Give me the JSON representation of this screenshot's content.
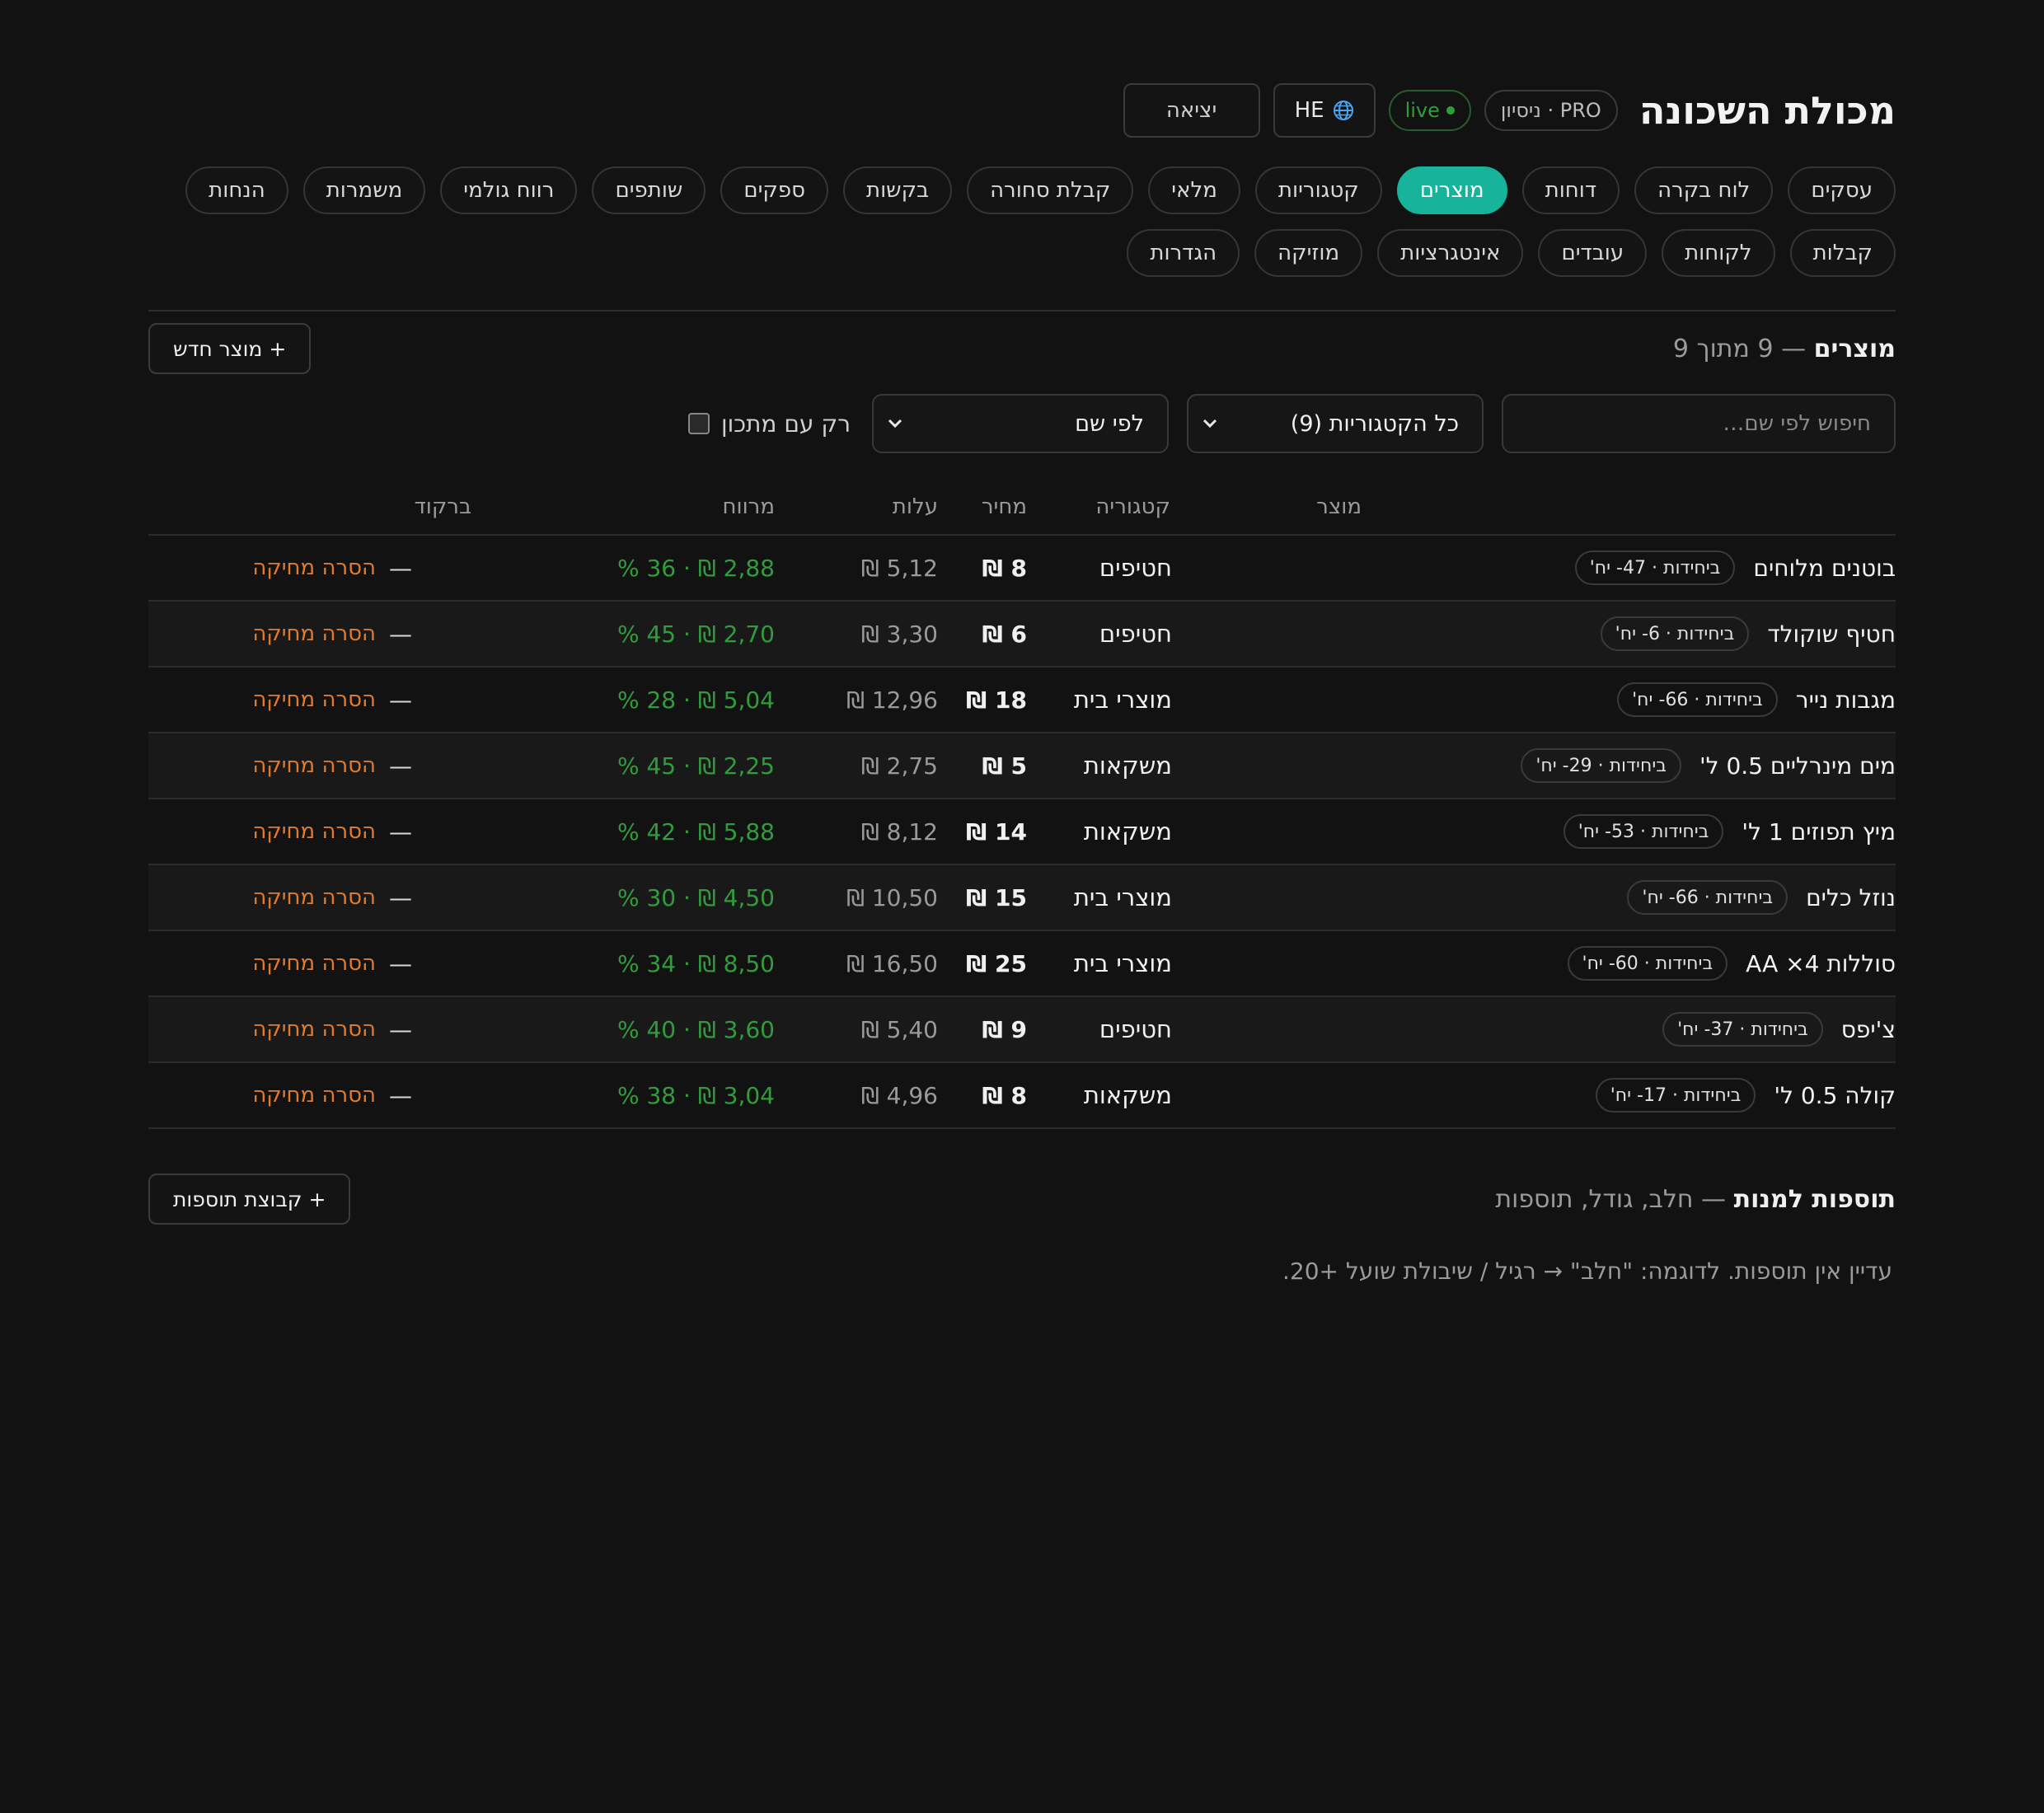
{
  "app": {
    "title": "מכולת השכונה",
    "plan_badge": "PRO · ניסיון",
    "live_label": "live",
    "lang_label": "HE",
    "logout_label": "יציאה"
  },
  "nav": {
    "items": [
      {
        "label": "עסקים"
      },
      {
        "label": "לוח בקרה"
      },
      {
        "label": "דוחות"
      },
      {
        "label": "מוצרים",
        "active": true
      },
      {
        "label": "קטגוריות"
      },
      {
        "label": "מלאי"
      },
      {
        "label": "קבלת סחורה"
      },
      {
        "label": "בקשות"
      },
      {
        "label": "ספקים"
      },
      {
        "label": "שותפים"
      },
      {
        "label": "רווח גולמי"
      },
      {
        "label": "משמרות"
      },
      {
        "label": "הנחות"
      },
      {
        "label": "קבלות"
      },
      {
        "label": "לקוחות"
      },
      {
        "label": "עובדים"
      },
      {
        "label": "אינטגרציות"
      },
      {
        "label": "מוזיקה"
      },
      {
        "label": "הגדרות"
      }
    ]
  },
  "products": {
    "title": "מוצרים",
    "count_text": "— 9 מתוך 9",
    "new_button": "+ מוצר חדש",
    "search_placeholder": "חיפוש לפי שם…",
    "category_filter": "כל הקטגוריות (9)",
    "sort_filter": "לפי שם",
    "only_recipe_label": "רק עם מתכון",
    "columns": {
      "product": "מוצר",
      "category": "קטגוריה",
      "price": "מחיר",
      "cost": "עלות",
      "margin": "מרווח",
      "barcode": "ברקוד"
    },
    "rows": [
      {
        "name": "בוטנים מלוחים",
        "unit": "ביחידות · 47- יח'",
        "category": "חטיפים",
        "price": "8 ₪",
        "cost": "5,12 ₪",
        "margin": "2,88 ₪ · 36 %",
        "barcode": "—",
        "action": "הסרה מחיקה"
      },
      {
        "name": "חטיף שוקולד",
        "unit": "ביחידות · 6- יח'",
        "category": "חטיפים",
        "price": "6 ₪",
        "cost": "3,30 ₪",
        "margin": "2,70 ₪ · 45 %",
        "barcode": "—",
        "action": "הסרה מחיקה"
      },
      {
        "name": "מגבות נייר",
        "unit": "ביחידות · 66- יח'",
        "category": "מוצרי בית",
        "price": "18 ₪",
        "cost": "12,96 ₪",
        "margin": "5,04 ₪ · 28 %",
        "barcode": "—",
        "action": "הסרה מחיקה"
      },
      {
        "name": "מים מינרליים 0.5 ל'",
        "unit": "ביחידות · 29- יח'",
        "category": "משקאות",
        "price": "5 ₪",
        "cost": "2,75 ₪",
        "margin": "2,25 ₪ · 45 %",
        "barcode": "—",
        "action": "הסרה מחיקה"
      },
      {
        "name": "מיץ תפוזים 1 ל'",
        "unit": "ביחידות · 53- יח'",
        "category": "משקאות",
        "price": "14 ₪",
        "cost": "8,12 ₪",
        "margin": "5,88 ₪ · 42 %",
        "barcode": "—",
        "action": "הסרה מחיקה"
      },
      {
        "name": "נוזל כלים",
        "unit": "ביחידות · 66- יח'",
        "category": "מוצרי בית",
        "price": "15 ₪",
        "cost": "10,50 ₪",
        "margin": "4,50 ₪ · 30 %",
        "barcode": "—",
        "action": "הסרה מחיקה"
      },
      {
        "name": "סוללות AA ×4",
        "unit": "ביחידות · 60- יח'",
        "category": "מוצרי בית",
        "price": "25 ₪",
        "cost": "16,50 ₪",
        "margin": "8,50 ₪ · 34 %",
        "barcode": "—",
        "action": "הסרה מחיקה"
      },
      {
        "name": "צ'יפס",
        "unit": "ביחידות · 37- יח'",
        "category": "חטיפים",
        "price": "9 ₪",
        "cost": "5,40 ₪",
        "margin": "3,60 ₪ · 40 %",
        "barcode": "—",
        "action": "הסרה מחיקה"
      },
      {
        "name": "קולה 0.5 ל'",
        "unit": "ביחידות · 17- יח'",
        "category": "משקאות",
        "price": "8 ₪",
        "cost": "4,96 ₪",
        "margin": "3,04 ₪ · 38 %",
        "barcode": "—",
        "action": "הסרה מחיקה"
      }
    ]
  },
  "addons": {
    "title": "תוספות למנות",
    "subtitle": "— חלב, גודל, תוספות",
    "new_button": "+ קבוצת תוספות",
    "empty_text": "עדיין אין תוספות. לדוגמה: \"חלב\" → רגיל / שיבולת שועל +20."
  },
  "colors": {
    "accent": "#17b39a",
    "live": "#2f9e3a",
    "margin": "#2f9e3a",
    "remove_link": "#e07a2c",
    "background": "#121212"
  },
  "icons": {
    "lang": "globe-icon",
    "select": "chevron-down-icon",
    "live": "dot-icon"
  }
}
